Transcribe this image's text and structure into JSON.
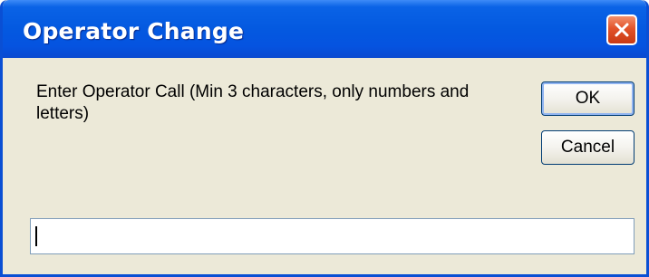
{
  "window": {
    "title": "Operator Change",
    "close_icon": "close-icon",
    "accent_color": "#0a4fd4",
    "close_color": "#e2532a"
  },
  "dialog": {
    "prompt": "Enter Operator Call (Min 3 characters, only numbers and letters)",
    "ok_label": "OK",
    "cancel_label": "Cancel",
    "input_value": "",
    "input_placeholder": ""
  }
}
